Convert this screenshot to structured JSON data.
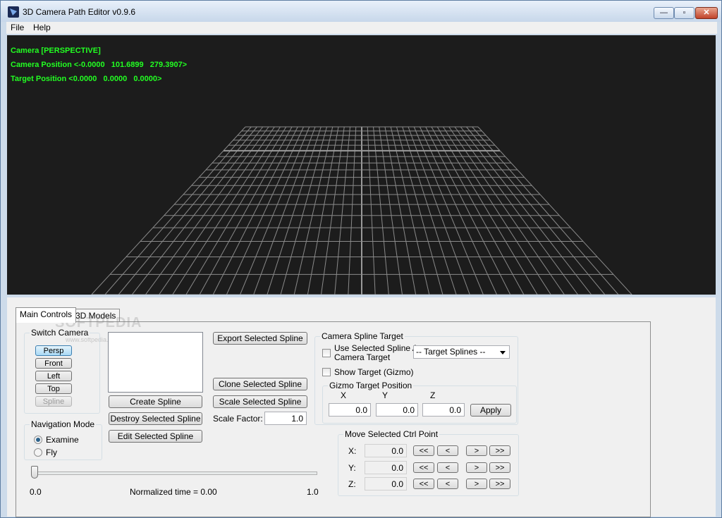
{
  "window": {
    "title": "3D Camera Path Editor v0.9.6",
    "controls": {
      "minimize": "—",
      "maximize": "▫",
      "close": "✕"
    }
  },
  "menu": {
    "items": [
      "File",
      "Help"
    ]
  },
  "viewport": {
    "camera_mode": "Camera [PERSPECTIVE]",
    "camera_position": "Camera Position <-0.0000   101.6899   279.3907>",
    "target_position": "Target Position <0.0000   0.0000   0.0000>",
    "colors": {
      "background": "#1c1c1c",
      "hud_text": "#22ff22",
      "grid": "#8a8a8a"
    }
  },
  "tabs": [
    {
      "label": "Main Controls"
    },
    {
      "label": "3D Models"
    }
  ],
  "watermark": {
    "text": "SOFTPEDIA",
    "sub": "www.softpedia.com"
  },
  "switch_camera": {
    "title": "Switch Camera",
    "buttons": [
      "Persp",
      "Front",
      "Left",
      "Top",
      "Spline"
    ]
  },
  "spline": {
    "create": "Create Spline",
    "destroy": "Destroy Selected Spline",
    "edit": "Edit Selected Spline",
    "export": "Export Selected Spline",
    "clone": "Clone Selected Spline",
    "scale": "Scale Selected Spline",
    "scale_factor_label": "Scale Factor:",
    "scale_factor_value": "1.0"
  },
  "navigation": {
    "title": "Navigation Mode",
    "options": [
      "Examine",
      "Fly"
    ],
    "selected": "Examine"
  },
  "time_slider": {
    "min": "0.0",
    "max": "1.0",
    "label": "Normalized time = 0.00",
    "value": 0.0
  },
  "camera_spline_target": {
    "title": "Camera Spline Target",
    "use_spline_label_1": "Use Selected Spline As",
    "use_spline_label_2": "Camera Target",
    "show_target_label": "Show Target (Gizmo)",
    "combo_value": "-- Target Splines --"
  },
  "gizmo": {
    "title": "Gizmo Target Position",
    "x_label": "X",
    "y_label": "Y",
    "z_label": "Z",
    "x": "0.0",
    "y": "0.0",
    "z": "0.0",
    "apply": "Apply"
  },
  "move_ctrl": {
    "title": "Move Selected Ctrl Point",
    "rows": [
      {
        "label": "X:",
        "value": "0.0"
      },
      {
        "label": "Y:",
        "value": "0.0"
      },
      {
        "label": "Z:",
        "value": "0.0"
      }
    ],
    "btn_fast_back": "<<",
    "btn_back": "<",
    "btn_fwd": ">",
    "btn_fast_fwd": ">>"
  }
}
